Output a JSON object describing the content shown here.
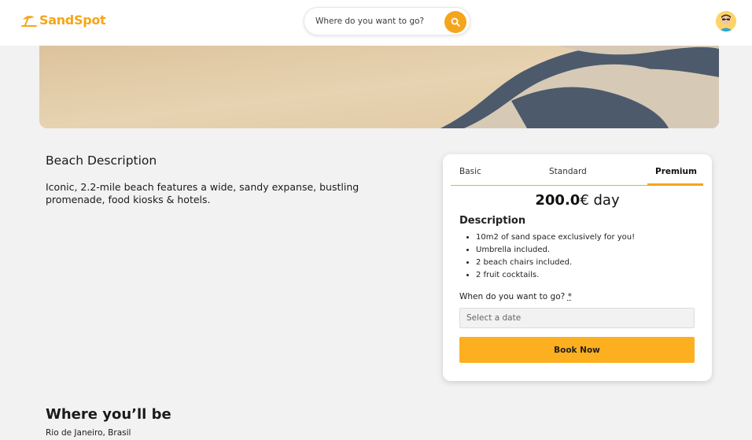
{
  "brand": {
    "name": "SandSpot",
    "color": "#f5a51b"
  },
  "search": {
    "placeholder": "Where do you want to go?",
    "icon": "search-icon"
  },
  "user": {
    "avatar_icon": "user-avatar-icon"
  },
  "beach": {
    "description_title": "Beach Description",
    "description": "Iconic, 2.2-mile beach features a wide, sandy expanse, bustling promenade, food kiosks & hotels.",
    "location_title": "Where you’ll be",
    "location": "Rio de Janeiro, Brasil"
  },
  "booking": {
    "tabs": [
      {
        "label": "Basic",
        "selected": false
      },
      {
        "label": "Standard",
        "selected": false
      },
      {
        "label": "Premium",
        "selected": true
      }
    ],
    "price_amount": "200.0",
    "price_suffix": "€ day",
    "description_title": "Description",
    "features": [
      "10m2 of sand space exclusively for you!",
      "Umbrella included.",
      "2 beach chairs included.",
      "2 fruit cocktails."
    ],
    "date_label": "When do you want to go?",
    "date_required": "*",
    "date_placeholder": "Select a date",
    "book_label": "Book Now",
    "accent": "#fcb020"
  }
}
